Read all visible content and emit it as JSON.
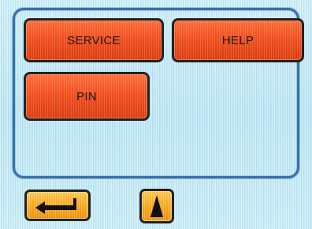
{
  "menu": {
    "service_label": "SERVICE",
    "help_label": "HELP",
    "pin_label": "PIN"
  },
  "nav": {
    "back_icon": "return-arrow-icon",
    "up_icon": "up-arrow-icon"
  },
  "colors": {
    "screen_background": "#bfe6f3",
    "panel_border": "#3a6fa8",
    "menu_button": "#ee4a1c",
    "nav_button": "#f7a318",
    "button_border": "#222222"
  }
}
